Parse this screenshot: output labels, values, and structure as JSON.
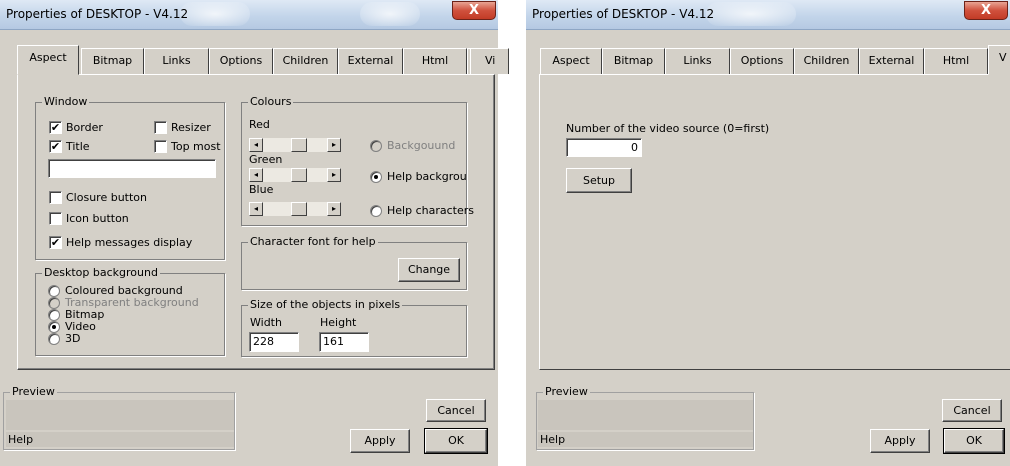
{
  "window1": {
    "title": "Properties of DESKTOP - V4.12",
    "close_glyph": "X",
    "tabs": [
      "Aspect",
      "Bitmap",
      "Links",
      "Options",
      "Children",
      "External",
      "Html",
      "Vi"
    ],
    "window_group": {
      "legend": "Window",
      "border": {
        "label": "Border",
        "checked": true
      },
      "resizer": {
        "label": "Resizer",
        "checked": false
      },
      "title": {
        "label": "Title",
        "checked": true
      },
      "top_most": {
        "label": "Top most",
        "checked": false
      },
      "title_value": "",
      "closure_button": {
        "label": "Closure button",
        "checked": false
      },
      "icon_button": {
        "label": "Icon button",
        "checked": false
      },
      "help_messages": {
        "label": "Help messages display",
        "checked": true
      }
    },
    "colours_group": {
      "legend": "Colours",
      "red": "Red",
      "green": "Green",
      "blue": "Blue",
      "radio_background": "Backgouund",
      "radio_help_background": "Help backgrou",
      "radio_help_characters": "Help characters",
      "selected": "help_background"
    },
    "font_group": {
      "legend": "Character font for help",
      "change_button": "Change"
    },
    "desktop_bg_group": {
      "legend": "Desktop background",
      "options": [
        "Coloured background",
        "Transparent background",
        "Bitmap",
        "Video",
        "3D"
      ],
      "selected_index": 3,
      "disabled_index": 1
    },
    "size_group": {
      "legend": "Size of the objects in pixels",
      "width_label": "Width",
      "height_label": "Height",
      "width_value": "228",
      "height_value": "161"
    },
    "preview_label": "Preview",
    "help_text": "Help",
    "cancel_button": "Cancel",
    "apply_button": "Apply",
    "ok_button": "OK"
  },
  "window2": {
    "title": "Properties of DESKTOP - V4.12",
    "close_glyph": "X",
    "tabs": [
      "Aspect",
      "Bitmap",
      "Links",
      "Options",
      "Children",
      "External",
      "Html",
      "V"
    ],
    "video_source_label": "Number of the video source (0=first)",
    "video_source_value": "0",
    "setup_button": "Setup",
    "preview_label": "Preview",
    "help_text": "Help",
    "cancel_button": "Cancel",
    "apply_button": "Apply",
    "ok_button": "OK"
  },
  "icons": {
    "checkmark": "✔",
    "arrow_left": "◂",
    "arrow_right": "▸"
  },
  "colors": {
    "dialog_face": "#d4d0c8",
    "title_gradient_top": "#dfe9f5",
    "close_red": "#c23b26"
  }
}
